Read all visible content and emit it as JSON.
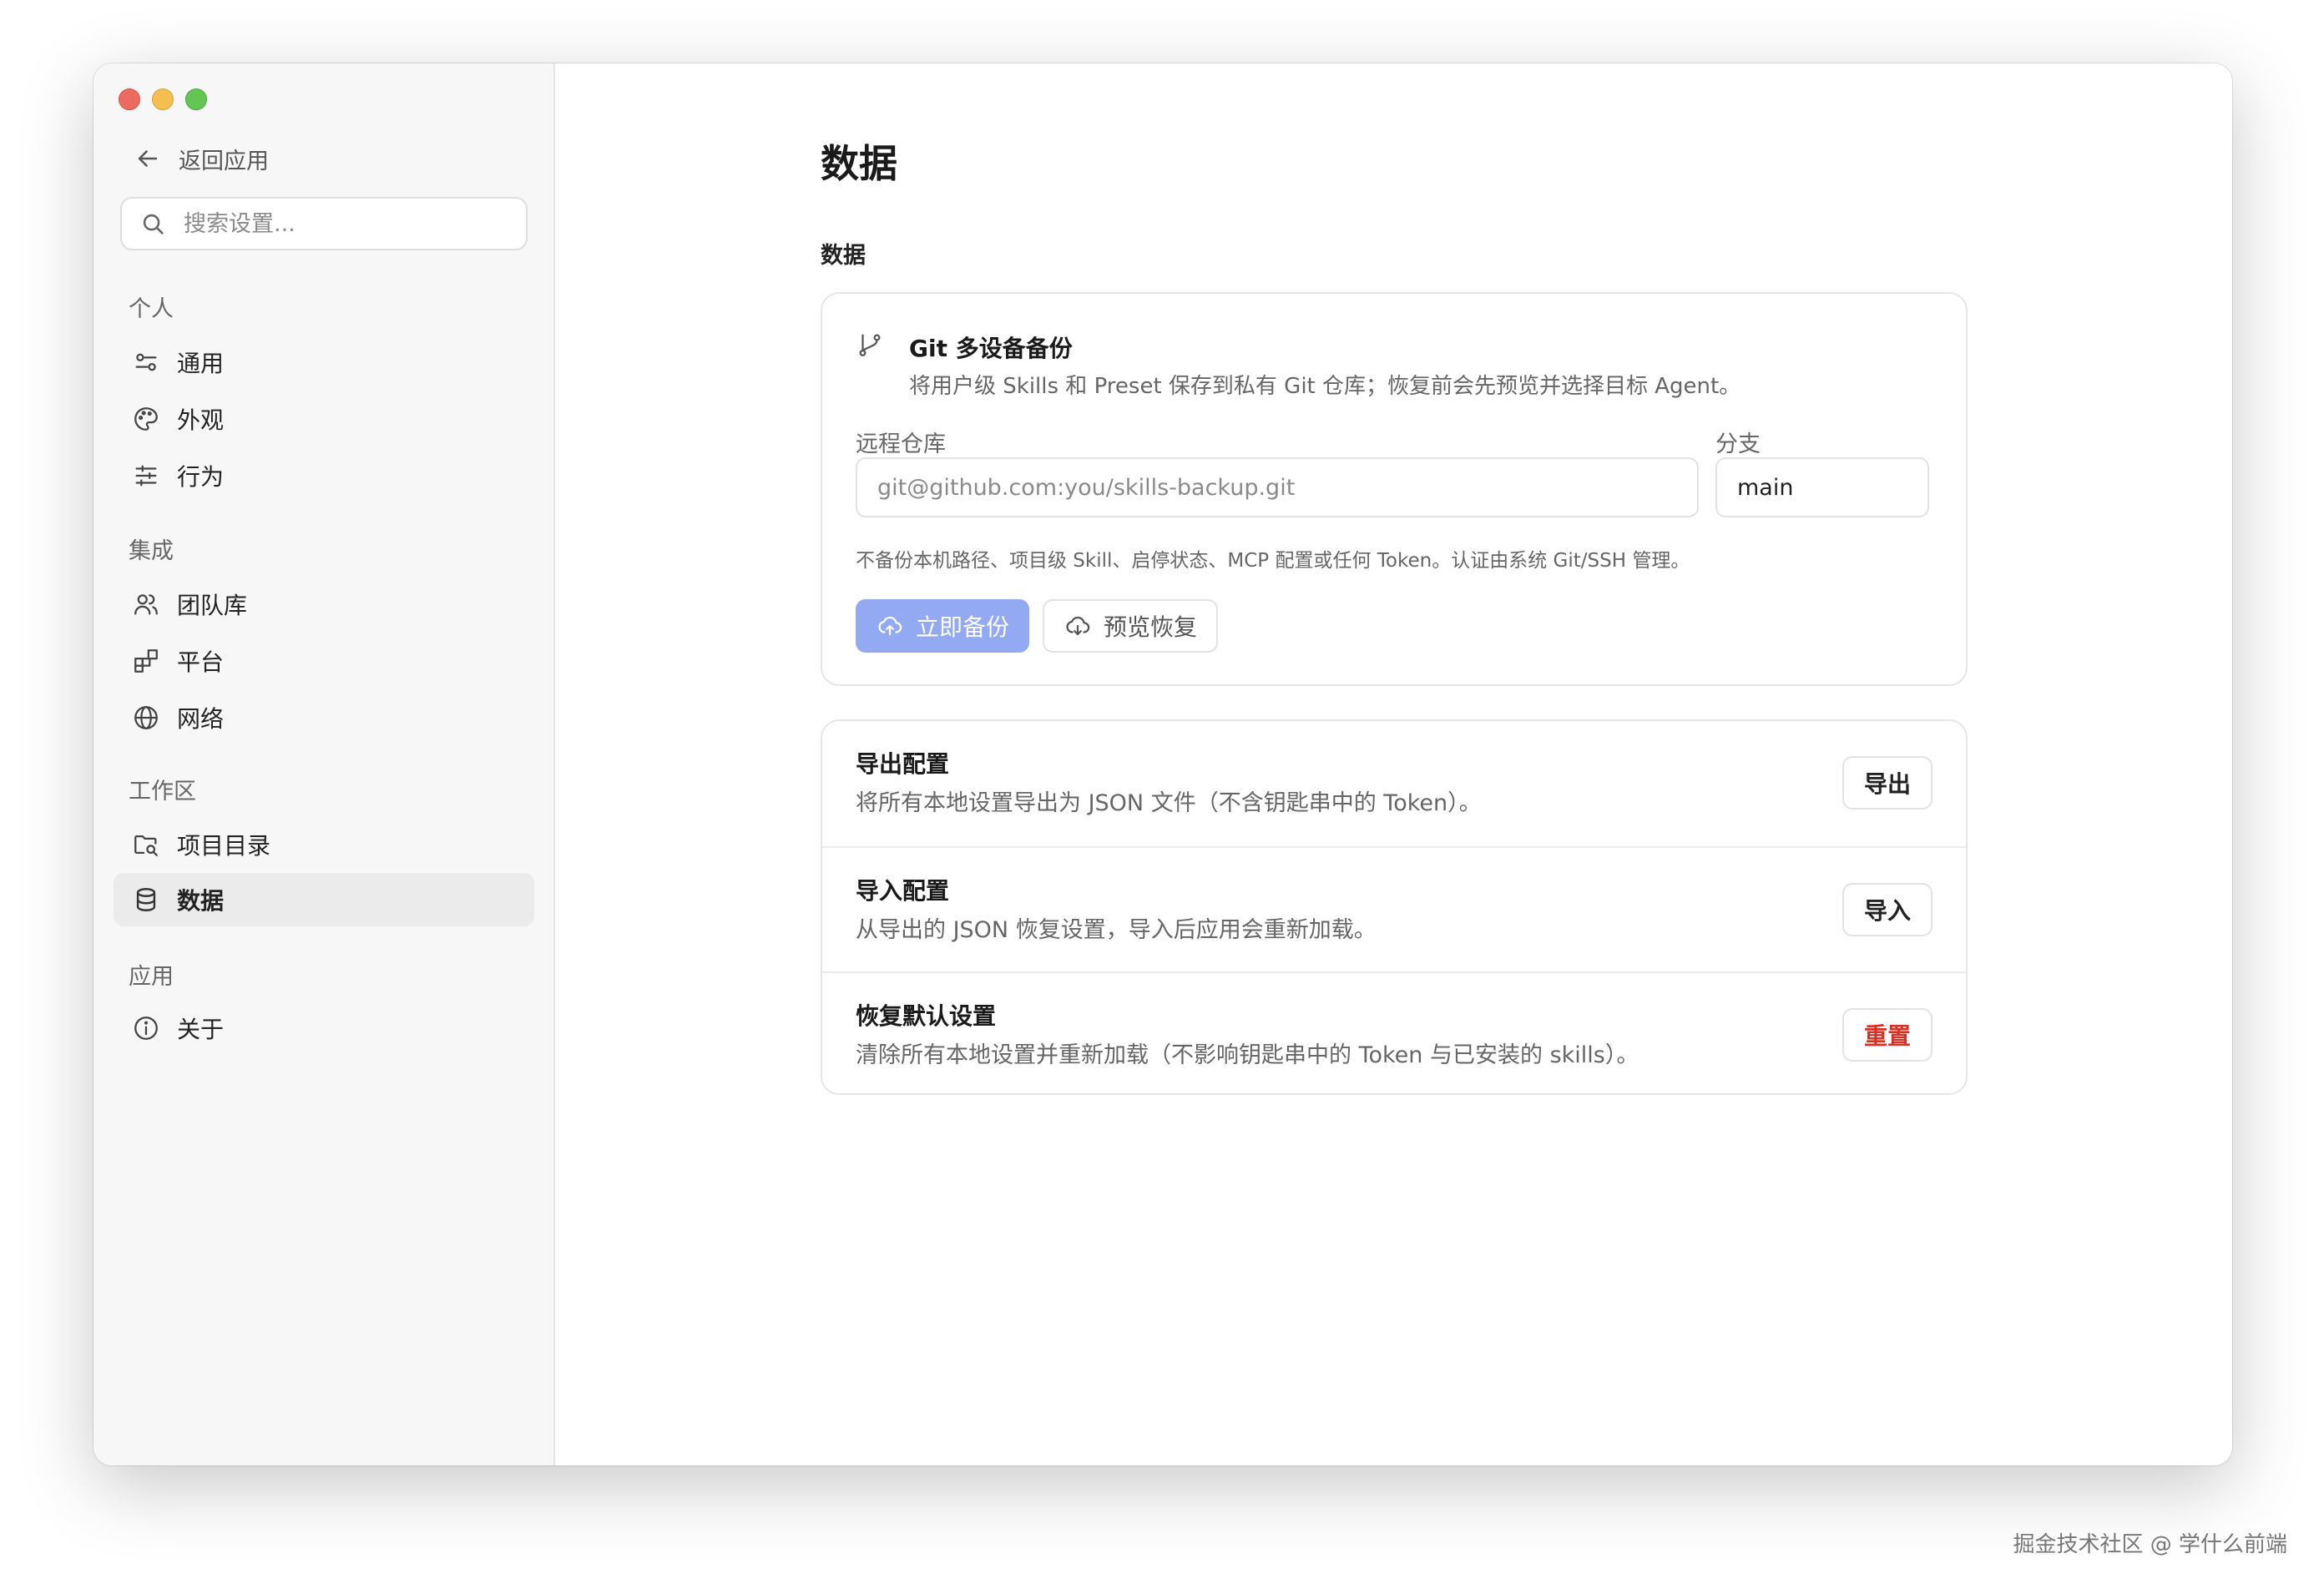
{
  "sidebar": {
    "back_label": "返回应用",
    "search_placeholder": "搜索设置...",
    "sections": [
      {
        "label": "个人",
        "items": [
          {
            "label": "通用",
            "icon": "toggles-icon"
          },
          {
            "label": "外观",
            "icon": "palette-icon"
          },
          {
            "label": "行为",
            "icon": "sliders-icon"
          }
        ]
      },
      {
        "label": "集成",
        "items": [
          {
            "label": "团队库",
            "icon": "users-icon"
          },
          {
            "label": "平台",
            "icon": "blocks-icon"
          },
          {
            "label": "网络",
            "icon": "globe-icon"
          }
        ]
      },
      {
        "label": "工作区",
        "items": [
          {
            "label": "项目目录",
            "icon": "folder-search-icon"
          },
          {
            "label": "数据",
            "icon": "database-icon",
            "active": true
          }
        ]
      },
      {
        "label": "应用",
        "items": [
          {
            "label": "关于",
            "icon": "info-icon"
          }
        ]
      }
    ]
  },
  "main": {
    "title": "数据",
    "group_label": "数据",
    "git_backup": {
      "icon": "git-branch-icon",
      "title": "Git 多设备备份",
      "description": "将用户级 Skills 和 Preset 保存到私有 Git 仓库；恢复前会先预览并选择目标 Agent。",
      "remote_label": "远程仓库",
      "remote_placeholder": "git@github.com:you/skills-backup.git",
      "branch_label": "分支",
      "branch_value": "main",
      "note": "不备份本机路径、项目级 Skill、启停状态、MCP 配置或任何 Token。认证由系统 Git/SSH 管理。",
      "backup_button": "立即备份",
      "preview_button": "预览恢复"
    },
    "actions": [
      {
        "title": "导出配置",
        "description": "将所有本地设置导出为 JSON 文件（不含钥匙串中的 Token）。",
        "button": "导出"
      },
      {
        "title": "导入配置",
        "description": "从导出的 JSON 恢复设置，导入后应用会重新加载。",
        "button": "导入"
      },
      {
        "title": "恢复默认设置",
        "description": "清除所有本地设置并重新加载（不影响钥匙串中的 Token 与已安装的 skills）。",
        "button": "重置"
      }
    ],
    "colors": {
      "primary_button": "#93aaf3",
      "danger": "#d93025"
    }
  },
  "watermark": "掘金技术社区 @ 学什么前端"
}
